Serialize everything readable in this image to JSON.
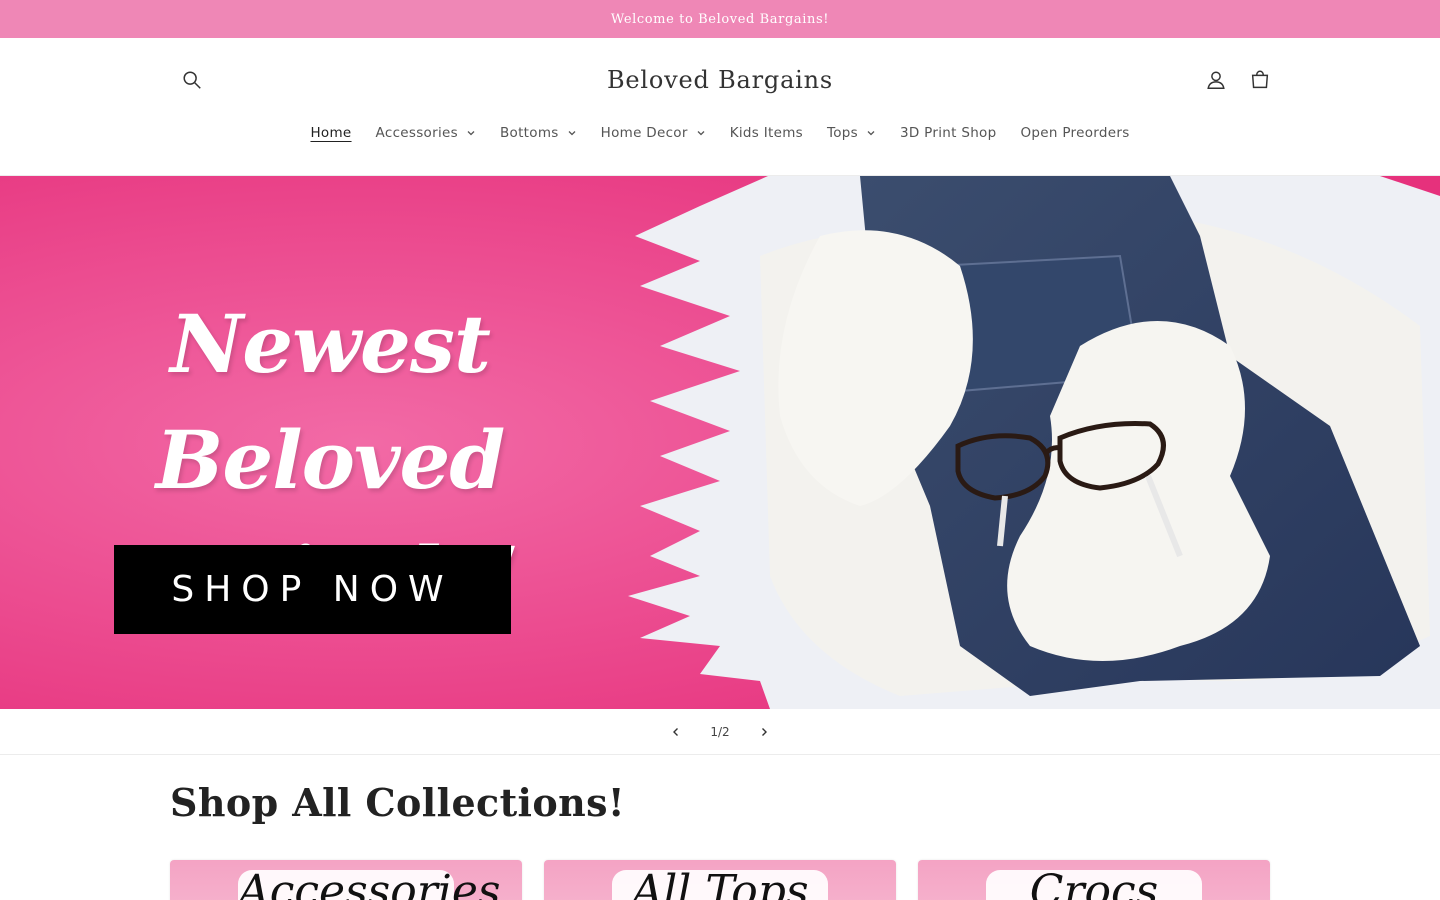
{
  "announcement": {
    "text": "Welcome to Beloved Bargains!"
  },
  "header": {
    "logo": "Beloved Bargains",
    "icons": {
      "search": "search-icon",
      "account": "user-icon",
      "cart": "cart-icon"
    }
  },
  "nav": {
    "items": [
      {
        "label": "Home",
        "active": true,
        "has_dropdown": false
      },
      {
        "label": "Accessories",
        "has_dropdown": true
      },
      {
        "label": "Bottoms",
        "has_dropdown": true
      },
      {
        "label": "Home Decor",
        "has_dropdown": true
      },
      {
        "label": "Kids Items",
        "has_dropdown": false
      },
      {
        "label": "Tops",
        "has_dropdown": true
      },
      {
        "label": "3D Print Shop",
        "has_dropdown": false
      },
      {
        "label": "Open Preorders",
        "has_dropdown": false
      }
    ]
  },
  "hero": {
    "title_line1": "Newest Beloved",
    "title_line2": "Arrivals!",
    "cta": "SHOP NOW"
  },
  "slider": {
    "counter": "1/2"
  },
  "collections": {
    "title": "Shop All Collections!",
    "cards": [
      {
        "script": "Accessories"
      },
      {
        "script": "All Tops"
      },
      {
        "script": "Crocs"
      }
    ]
  },
  "colors": {
    "announcement_bg": "#ef87b6",
    "hero_pink": "#e8357f",
    "cta_bg": "#000000"
  }
}
